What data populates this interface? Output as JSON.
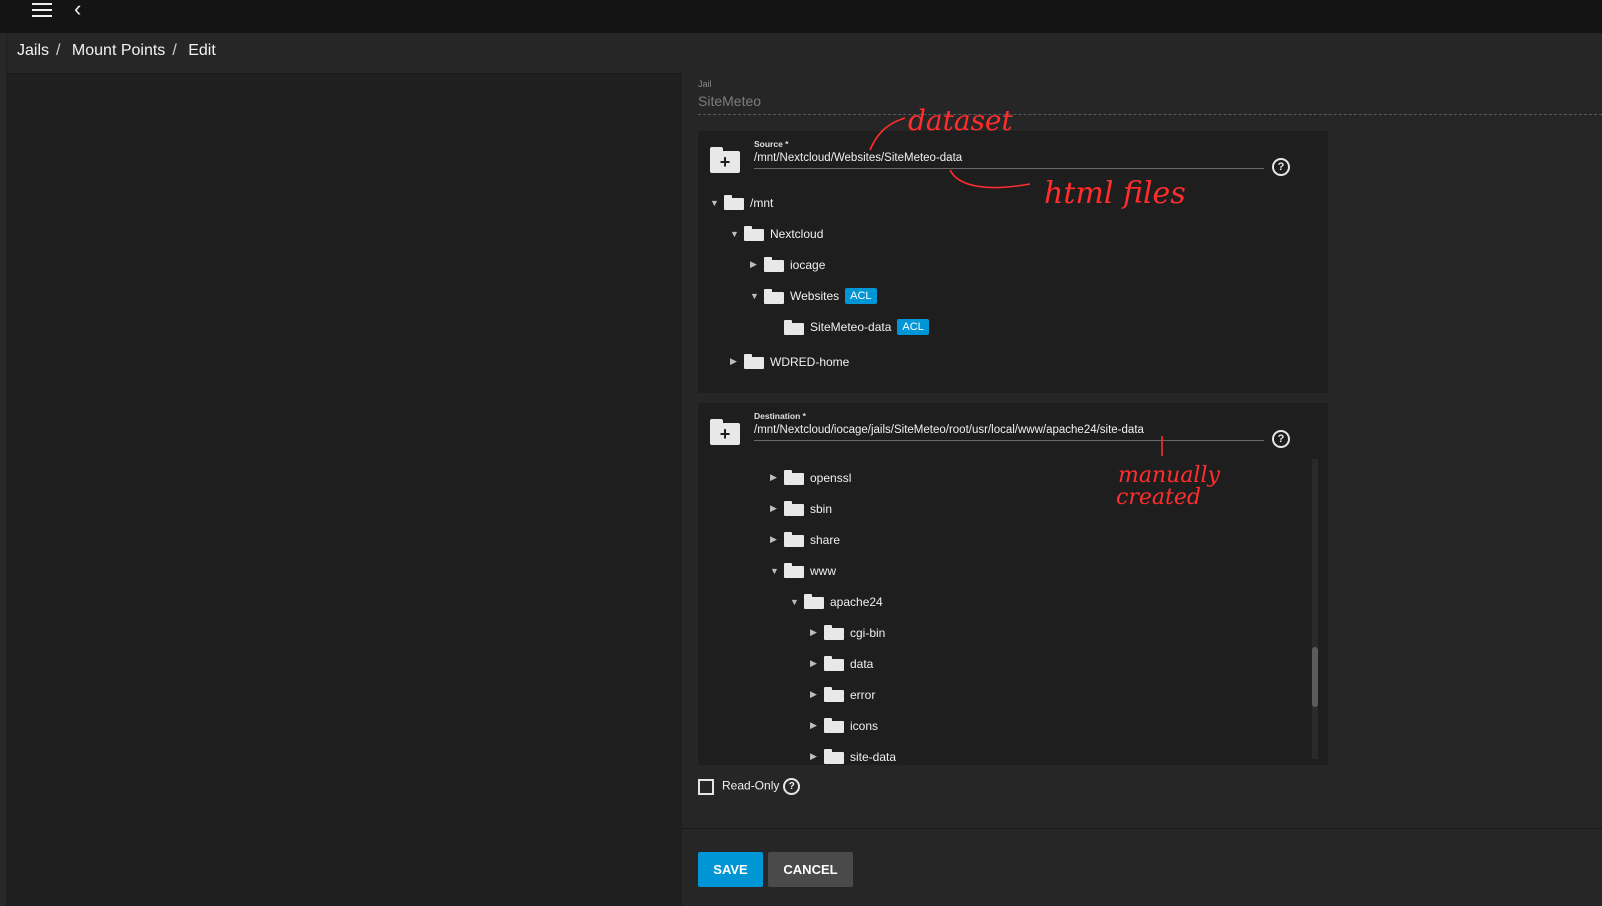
{
  "breadcrumb": [
    "Jails",
    "Mount Points",
    "Edit"
  ],
  "jail": {
    "label": "Jail",
    "value": "SiteMeteo"
  },
  "source": {
    "label": "Source *",
    "value": "/mnt/Nextcloud/Websites/SiteMeteo-data",
    "tree": [
      {
        "label": "/mnt",
        "toggle": "▼",
        "acl": ""
      },
      {
        "label": "Nextcloud",
        "toggle": "▼",
        "acl": ""
      },
      {
        "label": "iocage",
        "toggle": "▶",
        "acl": ""
      },
      {
        "label": "Websites",
        "toggle": "▼",
        "acl": "ACL"
      },
      {
        "label": "SiteMeteo-data",
        "toggle": "",
        "acl": "ACL"
      },
      {
        "label": "WDRED-home",
        "toggle": "▶",
        "acl": ""
      }
    ]
  },
  "destination": {
    "label": "Destination *",
    "value": "/mnt/Nextcloud/iocage/jails/SiteMeteo/root/usr/local/www/apache24/site-data",
    "tree": [
      {
        "label": "openssl",
        "toggle": "▶"
      },
      {
        "label": "sbin",
        "toggle": "▶"
      },
      {
        "label": "share",
        "toggle": "▶"
      },
      {
        "label": "www",
        "toggle": "▼"
      },
      {
        "label": "apache24",
        "toggle": "▼"
      },
      {
        "label": "cgi-bin",
        "toggle": "▶"
      },
      {
        "label": "data",
        "toggle": "▶"
      },
      {
        "label": "error",
        "toggle": "▶"
      },
      {
        "label": "icons",
        "toggle": "▶"
      },
      {
        "label": "site-data",
        "toggle": "▶"
      }
    ]
  },
  "readonly": {
    "label": "Read-Only",
    "checked": false
  },
  "buttons": {
    "save": "SAVE",
    "cancel": "CANCEL"
  },
  "annotations": [
    "dataset",
    "html files",
    "manually",
    "created"
  ],
  "colors": {
    "accent": "#0095d5",
    "annotation": "#ff2d2d"
  }
}
